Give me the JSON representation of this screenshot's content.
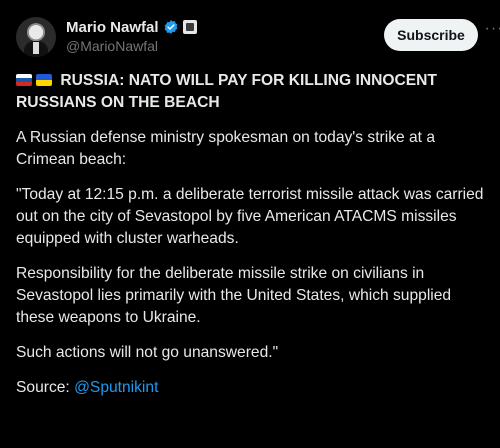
{
  "author": {
    "display_name": "Mario Nawfal",
    "handle": "@MarioNawfal"
  },
  "actions": {
    "subscribe_label": "Subscribe",
    "more_label": "···"
  },
  "tweet": {
    "headline": "RUSSIA: NATO WILL PAY FOR KILLING INNOCENT RUSSIANS ON THE BEACH",
    "paragraphs": [
      "A Russian defense ministry spokesman on today's strike at a Crimean beach:",
      "\"Today at 12:15 p.m. a deliberate terrorist missile attack was carried out on the city of Sevastopol by five American ATACMS missiles equipped with cluster warheads.",
      "Responsibility for the deliberate missile strike on civilians in Sevastopol lies primarily with the United States, which supplied these weapons to Ukraine.",
      "Such actions will not go unanswered.\""
    ],
    "source_label": "Source:",
    "source_link": "@Sputnikint"
  },
  "icons": {
    "flag_1": "russia-flag-icon",
    "flag_2": "ukraine-flag-icon",
    "verified": "verified-badge-icon",
    "affiliation": "affiliation-badge-icon"
  },
  "colors": {
    "background": "#000000",
    "text": "#e7e9ea",
    "secondary_text": "#71767b",
    "link": "#1d9bf0",
    "verified_badge": "#1d9bf0",
    "subscribe_bg": "#eff3f4"
  }
}
